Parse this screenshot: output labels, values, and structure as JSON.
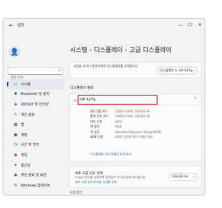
{
  "window": {
    "title": "설정",
    "back_glyph": "←",
    "controls": {
      "minimize": "—",
      "maximize": "☐",
      "close": "✕"
    }
  },
  "sidebar": {
    "avatar_glyph": "👤",
    "search_placeholder": "설정 검색",
    "search_glyph": "⌕",
    "items": [
      {
        "label": "시스템",
        "icon": "monitor-icon",
        "glyph": "▭",
        "color": "#0078d4",
        "active": true
      },
      {
        "label": "Bluetooth 및 장치",
        "icon": "bluetooth-icon",
        "glyph": "✱",
        "color": "#0067c0",
        "active": false
      },
      {
        "label": "네트워크 및 인터넷",
        "icon": "network-icon",
        "glyph": "◈",
        "color": "#0067c0",
        "active": false
      },
      {
        "label": "개인 설정",
        "icon": "personalization-icon",
        "glyph": "✎",
        "color": "#c55b11",
        "active": false
      },
      {
        "label": "앱",
        "icon": "apps-icon",
        "glyph": "▦",
        "color": "#5c5c5c",
        "active": false
      },
      {
        "label": "계정",
        "icon": "account-icon",
        "glyph": "●",
        "color": "#2a8b3e",
        "active": false
      },
      {
        "label": "시간 및 언어",
        "icon": "clock-icon",
        "glyph": "◷",
        "color": "#0067c0",
        "active": false
      },
      {
        "label": "게임",
        "icon": "gamepad-icon",
        "glyph": "◉",
        "color": "#5c5c5c",
        "active": false
      },
      {
        "label": "접근성",
        "icon": "accessibility-icon",
        "glyph": "✦",
        "color": "#0067c0",
        "active": false
      },
      {
        "label": "개인 정보 및 보안",
        "icon": "shield-icon",
        "glyph": "◆",
        "color": "#5c5c5c",
        "active": false
      },
      {
        "label": "Windows 업데이트",
        "icon": "update-icon",
        "glyph": "↻",
        "color": "#0067c0",
        "active": false
      }
    ]
  },
  "content": {
    "breadcrumb": [
      "시스템",
      "디스플레이",
      "고급 디스플레이"
    ],
    "breadcrumb_sep": "›",
    "select_prompt": "설정을 보거나 변경하려면 디스플레이를 선택합니다.",
    "display_select": "디스플레이 1: HP X27q",
    "section_label": "디스플레이 정보",
    "info": {
      "title": "HP X27q",
      "rows": [
        {
          "key": "데스크톱 모드",
          "value": "2560×1440, 164.83 Hz"
        },
        {
          "key": "활성 신호 모드",
          "value": "2560×1440, 164.83 Hz"
        },
        {
          "key": "비트 수준",
          "value": "8비트"
        },
        {
          "key": "색 형식",
          "value": "RGB"
        },
        {
          "key": "색 공간",
          "value": "Standard Dynamic Range(SDR)"
        },
        {
          "key": "HDR 인증",
          "value": "HDR 인증에 대한 자세한 정보"
        }
      ],
      "link": "디스플레이 1의 어댑터 속성 표시"
    },
    "refresh": {
      "title": "새로 고침 빈도 선택",
      "desc": "더 높은 빈도를 사용하면 움직임이 더 부드럽게 표시됩니다.",
      "link": "새로 고침 빈도에 대한 자세한 정보",
      "value": "164.83 Hz"
    },
    "help": "도움 받기"
  },
  "colors": {
    "accent": "#0067c0",
    "highlight": "#e02020"
  }
}
